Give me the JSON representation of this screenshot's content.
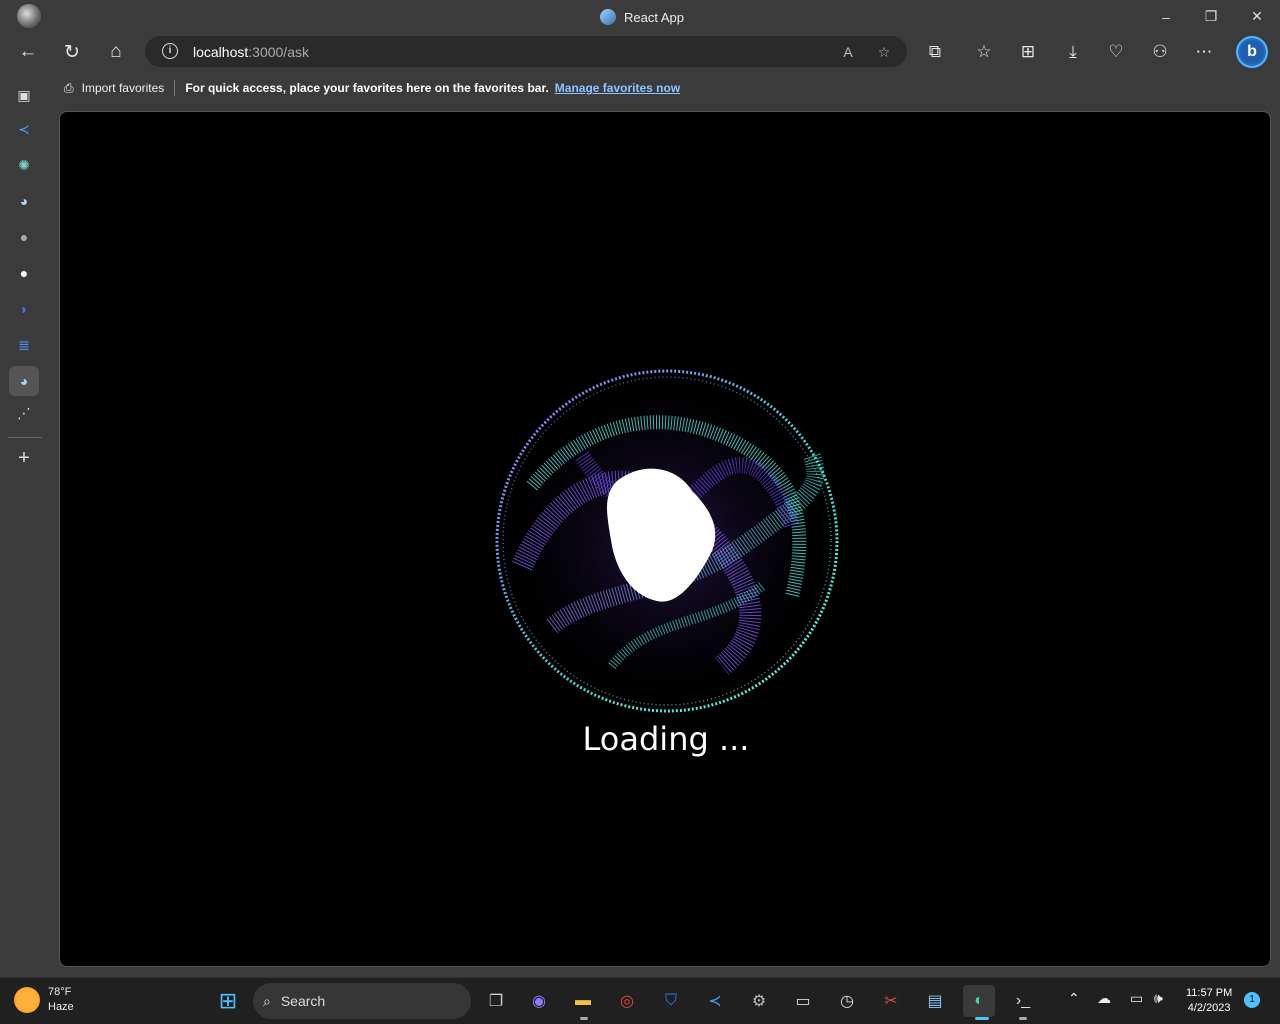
{
  "window": {
    "tab_title": "React App",
    "controls": {
      "minimize": "–",
      "restore": "❐",
      "close": "✕"
    }
  },
  "nav": {
    "url_host": "localhost",
    "url_path": ":3000/ask",
    "icons": [
      "back-icon",
      "refresh-icon",
      "home-icon",
      "site-info-icon",
      "read-aloud-icon",
      "add-favorite-icon",
      "extensions-icon",
      "favorites-icon",
      "collections-icon",
      "downloads-icon",
      "browser-essentials-icon",
      "profile-sync-icon",
      "more-icon",
      "bing-icon"
    ]
  },
  "favorites_bar": {
    "import_label": "Import favorites",
    "message": "For quick access, place your favorites here on the favorites bar.",
    "link": "Manage favorites now"
  },
  "sidebar": {
    "items": [
      "tab-actions-icon",
      "vscode-icon",
      "chatgpt-icon",
      "react-app-icon",
      "github-icon",
      "github-icon",
      "docs-icon",
      "notes-icon",
      "react-app-icon",
      "loading-icon",
      "add-icon"
    ]
  },
  "content": {
    "loading_text": "Loading ...",
    "colors": {
      "purple": "#8a5cff",
      "cyan": "#4fe6d6",
      "core": "#ffffff"
    }
  },
  "taskbar": {
    "weather_temp": "78°F",
    "weather_desc": "Haze",
    "search_label": "Search",
    "time": "11:57 PM",
    "date": "4/2/2023",
    "notification_count": "1"
  }
}
